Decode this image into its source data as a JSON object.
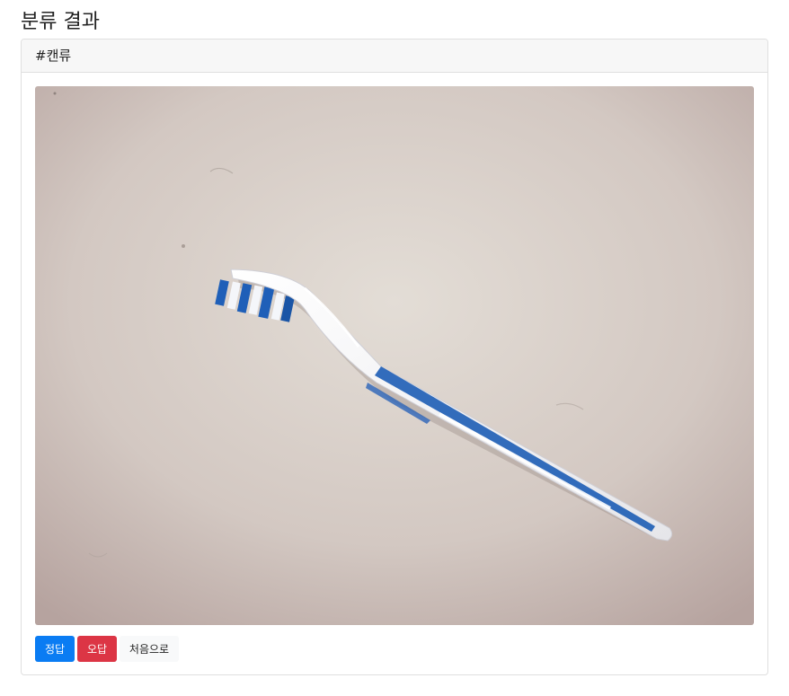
{
  "page": {
    "title": "분류 결과"
  },
  "card": {
    "header": "#캔류",
    "image_subject": "toothbrush"
  },
  "buttons": {
    "correct_label": "정답",
    "wrong_label": "오답",
    "restart_label": "처음으로"
  },
  "colors": {
    "primary": "#0a7cf3",
    "danger": "#dc3545",
    "light": "#f8f9fa"
  }
}
